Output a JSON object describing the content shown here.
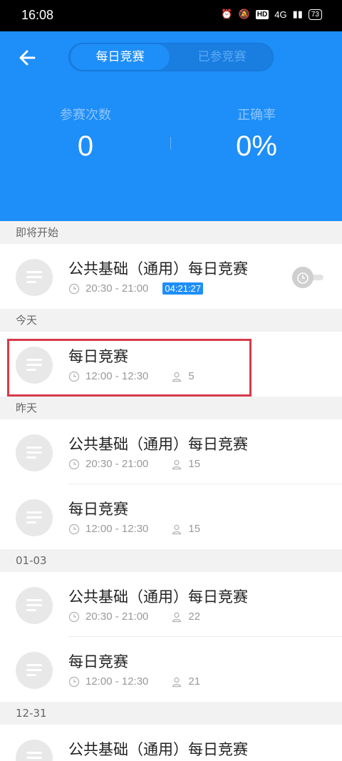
{
  "status": {
    "time": "16:08",
    "network": "4G",
    "battery": "73",
    "hd": "HD"
  },
  "tabs": [
    {
      "label": "每日竞赛",
      "active": true
    },
    {
      "label": "已参竞赛",
      "active": false
    }
  ],
  "stats": {
    "count_label": "参赛次数",
    "count_value": "0",
    "accuracy_label": "正确率",
    "accuracy_value": "0%"
  },
  "sections": [
    {
      "label": "即将开始",
      "items": [
        {
          "title": "公共基础（通用）每日竞赛",
          "time": "20:30 - 21:00",
          "countdown": "04:21:27"
        }
      ]
    },
    {
      "label": "今天",
      "items": [
        {
          "title": "每日竞赛",
          "time": "12:00 - 12:30",
          "participants": "5"
        }
      ]
    },
    {
      "label": "昨天",
      "items": [
        {
          "title": "公共基础（通用）每日竞赛",
          "time": "20:30 - 21:00",
          "participants": "15"
        },
        {
          "title": "每日竞赛",
          "time": "12:00 - 12:30",
          "participants": "15"
        }
      ]
    },
    {
      "label": "01-03",
      "items": [
        {
          "title": "公共基础（通用）每日竞赛",
          "time": "20:30 - 21:00",
          "participants": "22"
        },
        {
          "title": "每日竞赛",
          "time": "12:00 - 12:30",
          "participants": "21"
        }
      ]
    },
    {
      "label": "12-31",
      "items": [
        {
          "title": "公共基础（通用）每日竞赛"
        }
      ]
    }
  ],
  "colors": {
    "primary": "#1e8ef8",
    "highlight": "#d63a4a"
  }
}
